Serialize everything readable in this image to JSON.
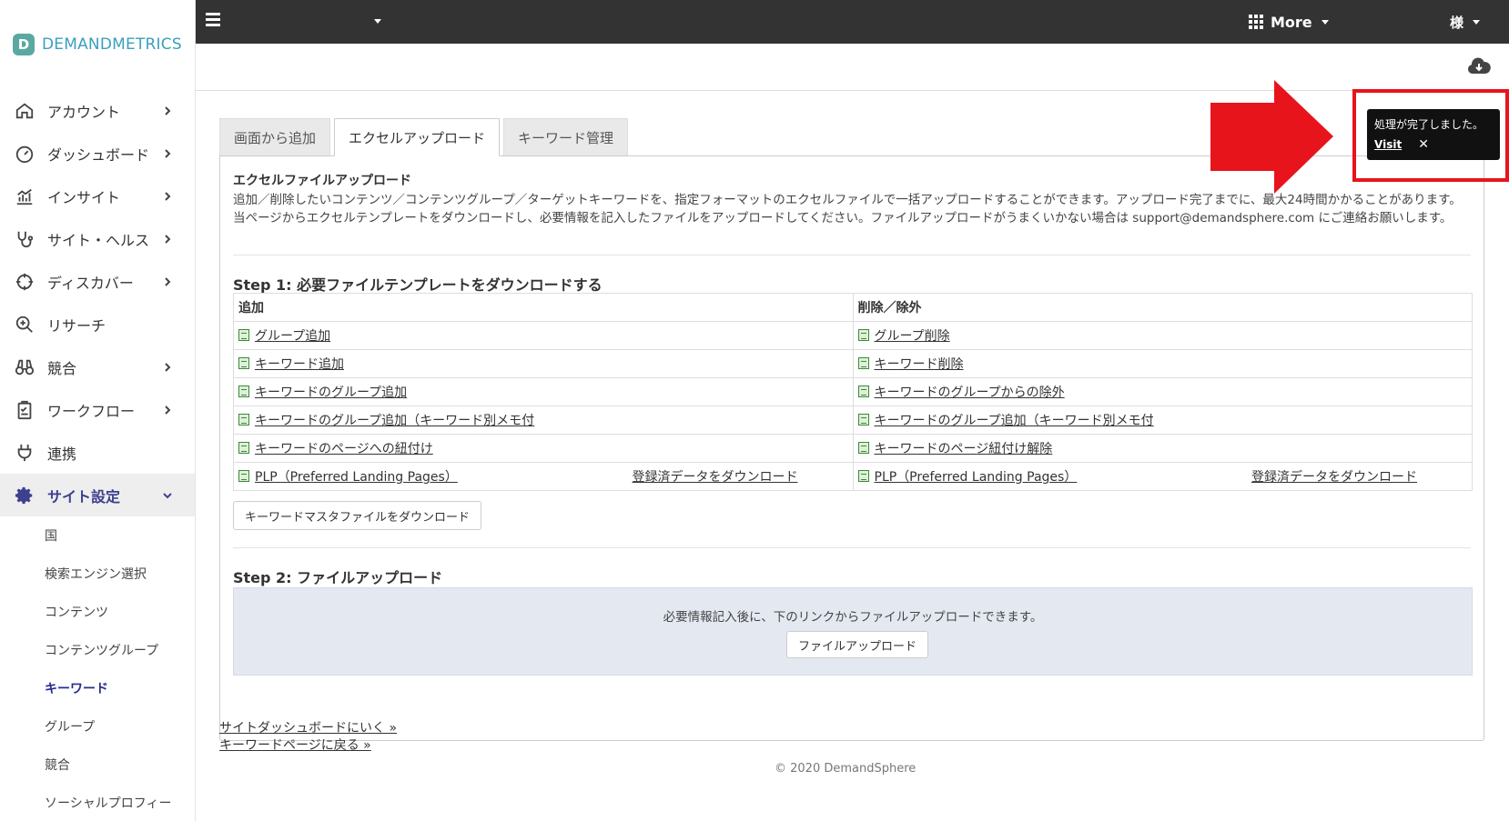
{
  "brand": {
    "name": "DEMANDMETRICS",
    "mark": "D"
  },
  "topbar": {
    "more_label": "More",
    "user_label": "様"
  },
  "sidebar": {
    "items": [
      {
        "label": "アカウント",
        "icon": "home-icon",
        "chevron": true
      },
      {
        "label": "ダッシュボード",
        "icon": "gauge-icon",
        "chevron": true
      },
      {
        "label": "インサイト",
        "icon": "chart-icon",
        "chevron": true
      },
      {
        "label": "サイト・ヘルス",
        "icon": "stethoscope-icon",
        "chevron": true
      },
      {
        "label": "ディスカバー",
        "icon": "crosshair-icon",
        "chevron": true
      },
      {
        "label": "リサーチ",
        "icon": "search-plus-icon",
        "chevron": false
      },
      {
        "label": "競合",
        "icon": "binoculars-icon",
        "chevron": true
      },
      {
        "label": "ワークフロー",
        "icon": "clipboard-icon",
        "chevron": true
      },
      {
        "label": "連携",
        "icon": "plug-icon",
        "chevron": false
      }
    ],
    "settings": {
      "label": "サイト設定",
      "icon": "gear-icon",
      "sub_items": [
        "国",
        "検索エンジン選択",
        "コンテンツ",
        "コンテンツグループ",
        "キーワード",
        "グループ",
        "競合",
        "ソーシャルプロフィー"
      ],
      "active": "キーワード"
    }
  },
  "tabs": [
    "画面から追加",
    "エクセルアップロード",
    "キーワード管理"
  ],
  "active_tab": "エクセルアップロード",
  "section": {
    "title": "エクセルファイルアップロード",
    "description": "追加／削除したいコンテンツ／コンテンツグループ／ターゲットキーワードを、指定フォーマットのエクセルファイルで一括アップロードすることができます。アップロード完了までに、最大24時間かかることがあります。当ページからエクセルテンプレートをダウンロードし、必要情報を記入したファイルをアップロードしてください。ファイルアップロードがうまくいかない場合は support@demandsphere.com にご連絡お願いします。"
  },
  "step1": {
    "title": "Step 1: 必要ファイルテンプレートをダウンロードする",
    "col_add": "追加",
    "col_remove": "削除／除外",
    "add_links": [
      "グループ追加",
      "キーワード追加",
      "キーワードのグループ追加",
      "キーワードのグループ追加（キーワード別メモ付",
      "キーワードのページへの紐付け",
      "PLP（Preferred Landing Pages）"
    ],
    "remove_links": [
      "グループ削除",
      "キーワード削除",
      "キーワードのグループからの除外",
      "キーワードのグループ追加（キーワード別メモ付",
      "キーワードのページ紐付け解除",
      "PLP（Preferred Landing Pages）"
    ],
    "registered_download": "登録済データをダウンロード",
    "master_button": "キーワードマスタファイルをダウンロード"
  },
  "step2": {
    "title": "Step 2: ファイルアップロード",
    "note": "必要情報記入後に、下のリンクからファイルアップロードできます。",
    "upload_button": "ファイルアップロード"
  },
  "footer": {
    "link_dashboard": "サイトダッシュボードにいく »",
    "link_keywords": "キーワードページに戻る »",
    "copyright": "© 2020 DemandSphere"
  },
  "toast": {
    "message": "処理が完了しました。",
    "visit": "Visit",
    "close": "✕"
  },
  "colors": {
    "topbar": "#333333",
    "accent": "#3d3f8f",
    "highlight": "#e8141c",
    "brand": "#3a9fbf"
  }
}
